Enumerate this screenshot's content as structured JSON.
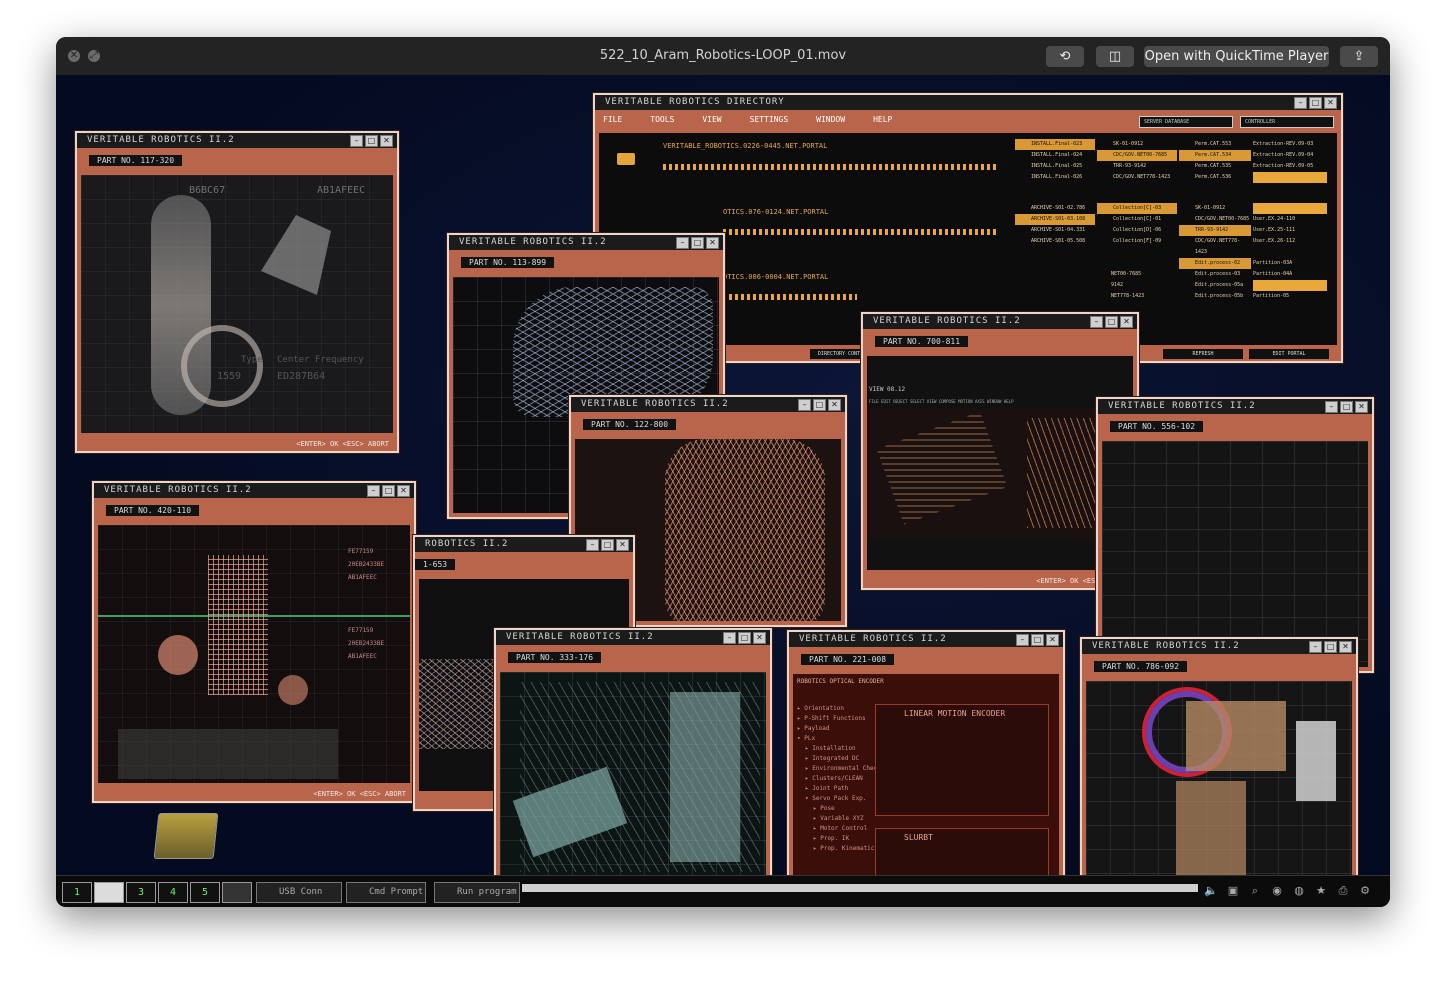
{
  "window": {
    "title": "522_10_Aram_Robotics-LOOP_01.mov",
    "open_with": "Open with QuickTime Player"
  },
  "directory": {
    "title": "VERITABLE ROBOTICS DIRECTORY",
    "menu": [
      "FILE",
      "TOOLS",
      "VIEW",
      "SETTINGS",
      "WINDOW",
      "HELP"
    ],
    "dropdown_1": "SERVER DATABASE",
    "dropdown_2": "CONTROLLER",
    "portals": [
      "VERITABLE_ROBOTICS.0226-0445.NET.PORTAL",
      "OTICS.076-0124.NET.PORTAL",
      "OTICS.006-0004.NET.PORTAL"
    ],
    "col1": [
      "INSTALL.Final-023",
      "INSTALL.Final-024",
      "INSTALL.Final-025",
      "INSTALL.Final-026"
    ],
    "col2": [
      "SK-01-0912",
      "CDC/GOV.NET00-7685",
      "TRR-93-9142",
      "CDC/GOV.NET778-1423"
    ],
    "col3": [
      "Perm.CAT.553",
      "Perm.CAT.534",
      "Perm.CAT.535",
      "Perm.CAT.536"
    ],
    "col4": [
      "Extraction-REV.09-03",
      "Extraction-REV.09-04",
      "Extraction-REV.09-05"
    ],
    "col1b": [
      "ARCHIVE-S01-02.786",
      "ARCHIVE-S01-03.108",
      "ARCHIVE-S01-04.331",
      "ARCHIVE-S01-05.508"
    ],
    "col2b": [
      "Collection[C]-03",
      "Collection[C]-01",
      "Collection[D]-06",
      "Collection[F]-09"
    ],
    "col3b": [
      "SK-01-0912",
      "CDC/GOV.NET00-7685",
      "TRR-93-9142",
      "CDC/GOV.NET778-1423"
    ],
    "col4b": [
      "User.EX.24-110",
      "User.EX.25-111",
      "User.EX.26-112"
    ],
    "col3c": [
      "Edit.process-02",
      "Edit.process-03",
      "Edit.process-05a",
      "Edit.process-05b"
    ],
    "col4c": [
      "Partition-03A",
      "Partition-04A",
      "Partition-05"
    ],
    "col2c": [
      "NET00-7685",
      "9142",
      "NET778-1423"
    ],
    "directory_cont": "DIRECTORY CONT",
    "refresh": "REFRESH",
    "edit_portal": "EDIT PORTAL"
  },
  "windows": {
    "app_title": "VERITABLE ROBOTICS II.2",
    "partial_title": "ROBOTICS II.2",
    "w1": {
      "part": "PART NO. 117-320",
      "hex1": "B6BC67",
      "hex2": "AB1AFEEC",
      "v1": "1559",
      "v2": "ED287B64",
      "lbl1": "Type",
      "lbl2": "Center Frequency"
    },
    "w2": {
      "part": "PART NO. 113-899"
    },
    "w3": {
      "part": "PART NO. 122-800"
    },
    "w4": {
      "part": "PART NO. 700-811",
      "view": "VIEW 08.12",
      "menu": "FILE   EDIT   OBJECT   SELECT   VIEW   COMPOSE   MOTION AXIS   WINDOW   HELP"
    },
    "w5": {
      "part": "PART NO. 556-102"
    },
    "w6": {
      "part": "PART NO. 420-110",
      "hex1": "FE77159",
      "hex2": "20EB2433BE",
      "hex3": "AB1AFEEC",
      "hex4": "FE77159",
      "hex5": "20EB2433BE",
      "hex6": "AB1AFEEC"
    },
    "w7": {
      "part": "1-653"
    },
    "w8": {
      "part": "PART NO. 333-176"
    },
    "w9": {
      "part": "PART NO. 221-008",
      "encoder": "ROBOTICS OPTICAL ENCODER",
      "linear": "LINEAR MOTION ENCODER",
      "slurbt": "SLURBT",
      "tree": [
        "▸ Orientation",
        "▸ P-Shift Functions",
        "▸ Payload",
        "▾ PLx",
        "▸ Installation",
        "▸ Integrated DC",
        "▸ Environmental Check",
        "▸ Clusters/CLEAN",
        "▸ Joint Path",
        "▾ Servo Pack Exp.",
        "▸ Pose",
        "▸ Variable XYZ",
        "▸ Motor Control",
        "▸ Prop. IK",
        "▸ Prop. Kinematics"
      ]
    },
    "w10": {
      "part": "PART NO. 786-092"
    },
    "footer": "<ENTER>   OK   <ESC> ABORT"
  },
  "taskbar": {
    "nums": [
      "1",
      "",
      "3",
      "4",
      "5",
      ""
    ],
    "usb": "USB Conn",
    "cmd": "Cmd Prompt",
    "run": "Run program"
  }
}
